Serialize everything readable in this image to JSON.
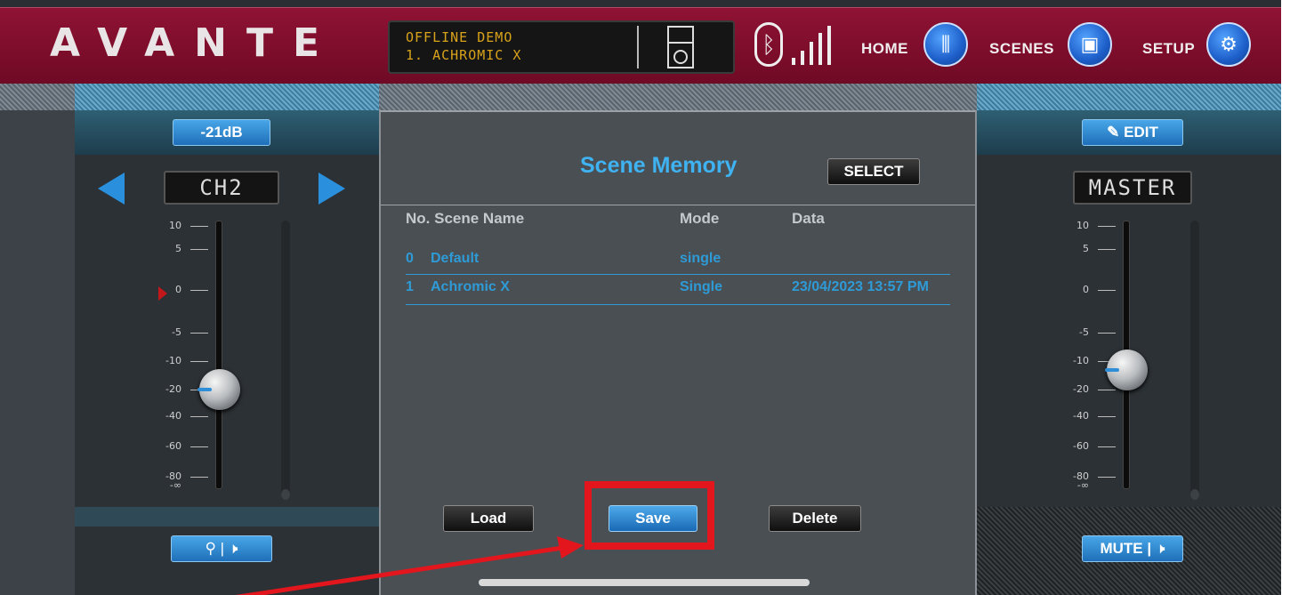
{
  "header": {
    "logo": "AVANTE",
    "lcd_line1": "OFFLINE DEMO",
    "lcd_line2": "1. ACHROMIC X",
    "nav": [
      {
        "label": "HOME",
        "icon": "mixer-icon"
      },
      {
        "label": "SCENES",
        "icon": "save-disk-icon"
      },
      {
        "label": "SETUP",
        "icon": "gear-icon"
      }
    ]
  },
  "left_channel": {
    "gain_label": "-21dB",
    "name": "CH2",
    "scale": [
      "10",
      "5",
      "0",
      "-5",
      "-10",
      "-20",
      "-40",
      "-60",
      "-80",
      "-∞"
    ],
    "fader_level_db": -20
  },
  "right_channel": {
    "edit_label": "EDIT",
    "name": "MASTER",
    "scale": [
      "10",
      "5",
      "0",
      "-5",
      "-10",
      "-20",
      "-40",
      "-60",
      "-80",
      "-∞"
    ],
    "fader_level_db": -10,
    "mute_label": "MUTE"
  },
  "scene_memory": {
    "title": "Scene Memory",
    "select_label": "SELECT",
    "columns": [
      "No. Scene Name",
      "Mode",
      "Data"
    ],
    "rows": [
      {
        "no": "0",
        "name": "Default",
        "mode": "single",
        "data": ""
      },
      {
        "no": "1",
        "name": "Achromic X",
        "mode": "Single",
        "data": "23/04/2023 13:57 PM"
      }
    ],
    "load_label": "Load",
    "save_label": "Save",
    "delete_label": "Delete"
  },
  "colors": {
    "header": "#8f1233",
    "accent_blue": "#3fb3f1",
    "highlight_red": "#e3161d"
  }
}
